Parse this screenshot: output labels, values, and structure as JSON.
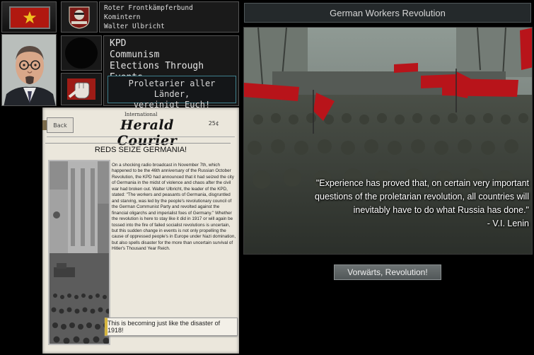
{
  "faction": {
    "name": "Roter Frontkämpferbund",
    "alliance": "Komintern",
    "leader": "Walter Ulbricht"
  },
  "country": {
    "party": "KPD",
    "ideology": "Communism",
    "elections": "Elections Through Events",
    "slogan_line1": "Proletarier aller Länder,",
    "slogan_line2": "vereinigt Euch!"
  },
  "colors": {
    "flag_red": "#b01810",
    "slogan_border": "#3e7f8c",
    "button_accent": "#d6b640"
  },
  "newspaper": {
    "international": "International",
    "masthead": "Herald Courier",
    "price": "25¢",
    "back_label": "Back",
    "headline": "REDS SEIZE GERMANIA!",
    "article": "On a shocking radio broadcast in November 7th, which happened to be the 46th anniversary of the Russian October Revolution, the KPD had announced that it had seized the city of Germania in the midst of violence and chaos after the civil war had broken out. Walter Ulbricht, the leader of the KPD, stated: \"The workers and peasants of Germania, disgruntled and starving, was led by the people's revolutionary council of the German Communist Party and revolted against the financial oligarchs and imperialist foes of Germany.\" Whether the revolution is here to stay like it did in 1917 or will again be tossed into the fire of failed socialist revolutions is uncertain, but this sudden change in events is not only propelling the cause of oppressed people's in Europe under Nazi domination, but also spells disaster for the more than uncertain survival of Hitler's Thousand Year Reich.",
    "response": "This is becoming just like the disaster of 1918!"
  },
  "event": {
    "title": "German Workers Revolution",
    "quote_line1": "\"Experience has proved that, on certain very important",
    "quote_line2": "questions of the proletarian revolution, all countries will",
    "quote_line3": "inevitably have to do what Russia has done.\"",
    "quote_author": "- V.I. Lenin",
    "option": "Vorwärts, Revolution!"
  },
  "icons": {
    "flag": "star-icon",
    "faction_emblem": "faction-emblem-icon",
    "fist": "raised-fist-icon"
  }
}
